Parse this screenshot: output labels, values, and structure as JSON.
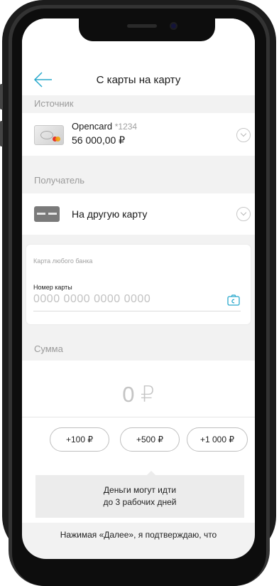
{
  "header": {
    "title": "С карты на карту"
  },
  "source": {
    "section_title": "Источник",
    "card_name": "Opencard",
    "card_mask": "*1234",
    "balance": "56 000,00 ₽"
  },
  "recipient": {
    "section_title": "Получатель",
    "option_label": "На другую карту",
    "panel_title": "Карта любого банка",
    "card_number_label": "Номер карты",
    "card_number_placeholder": "0000 0000 0000 0000",
    "card_number_value": ""
  },
  "amount": {
    "section_title": "Сумма",
    "value": "0 ₽",
    "chips": [
      "+100 ₽",
      "+500 ₽",
      "+1 000 ₽"
    ]
  },
  "info": {
    "line1": "Деньги могут идти",
    "line2": "до 3 рабочих дней"
  },
  "footer": {
    "text": "Нажимая «Далее», я подтверждаю, что"
  },
  "icons": {
    "back": "arrow-left-icon",
    "source_card": "card-thumbnail-icon",
    "recipient_card": "generic-card-icon",
    "expand": "chevron-down-icon",
    "scan": "camera-scan-icon"
  },
  "colors": {
    "accent": "#28a8cc",
    "background": "#f2f2f2"
  }
}
